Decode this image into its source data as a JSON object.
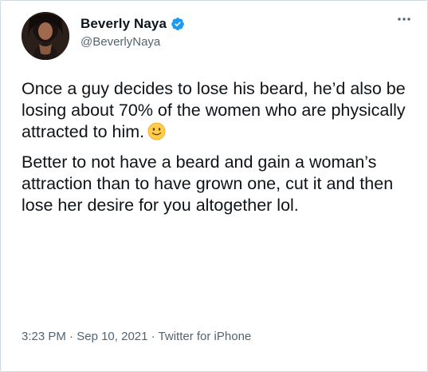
{
  "tweet": {
    "author": {
      "display_name": "Beverly Naya",
      "handle": "@BeverlyNaya",
      "verified": true
    },
    "more_icon": "more-horizontal-icon",
    "text_paragraph_1": "Once a guy decides to lose his beard, he’d also be losing about 70% of the women who are physically attracted to him.",
    "emoji": "slightly-smiling-face-emoji",
    "text_paragraph_2": "Better to not have a beard and gain a woman’s attraction than to have grown one, cut it and then lose her desire for you altogether lol.",
    "meta": {
      "time": "3:23 PM",
      "separator": " · ",
      "date": "Sep 10, 2021",
      "source": "Twitter for iPhone"
    }
  },
  "colors": {
    "text_primary": "#0f1419",
    "text_secondary": "#536471",
    "verified_blue": "#1d9bf0",
    "border": "#cfd9de"
  }
}
